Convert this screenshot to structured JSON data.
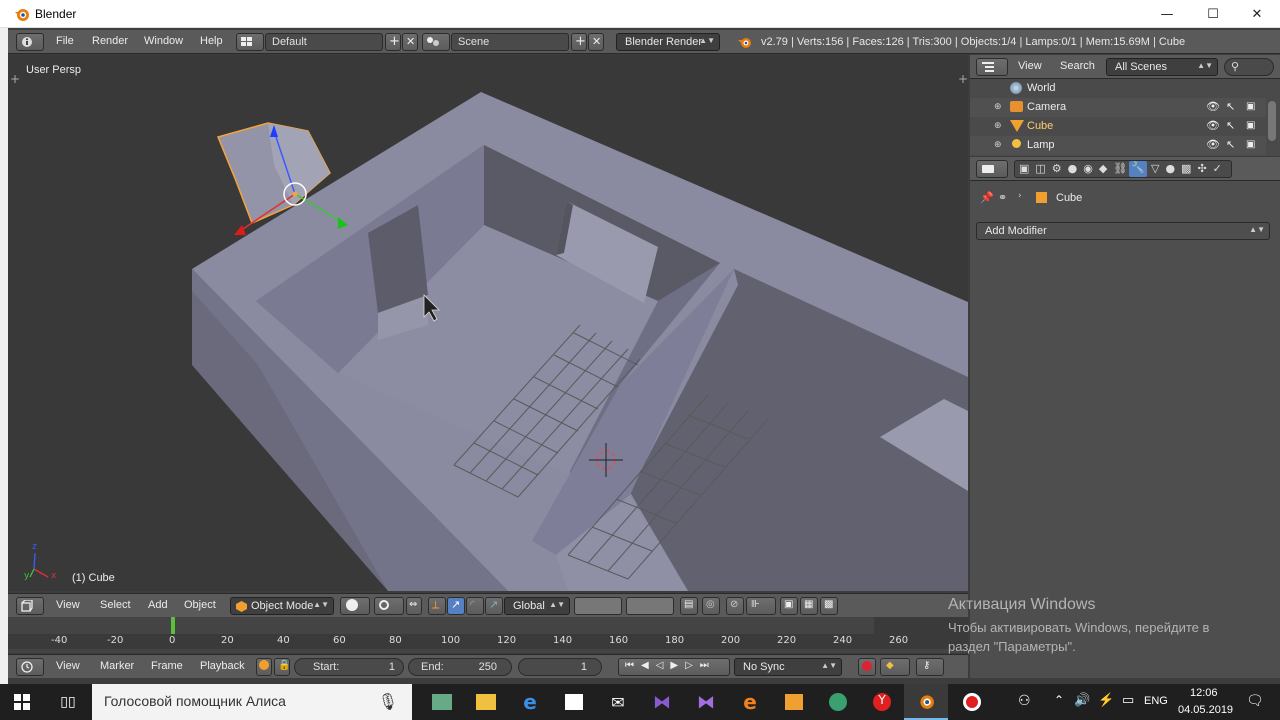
{
  "window": {
    "title": "Blender",
    "minimize": "—",
    "maximize": "☐",
    "close": "✕"
  },
  "info_header": {
    "menus": [
      "File",
      "Render",
      "Window",
      "Help"
    ],
    "layout": "Default",
    "scene": "Scene",
    "engine": "Blender Render",
    "stats": "v2.79 | Verts:156 | Faces:126 | Tris:300 | Objects:1/4 | Lamps:0/1 | Mem:15.69M | Cube"
  },
  "viewport": {
    "view_label": "User Persp",
    "object_label": "(1) Cube",
    "axes": {
      "x": "x",
      "y": "y",
      "z": "z"
    },
    "colors": {
      "bg": "#393939",
      "wall_top": "#8a8aa0",
      "wall_side": "#6d6d80",
      "floor": "#7a7a90",
      "dark_side": "#565661",
      "selection": "#f4a43a"
    }
  },
  "viewport_header": {
    "menus": [
      "View",
      "Select",
      "Add",
      "Object"
    ],
    "mode": "Object Mode",
    "orientation": "Global"
  },
  "timeline": {
    "ticks": [
      "-40",
      "-20",
      "0",
      "20",
      "40",
      "60",
      "80",
      "100",
      "120",
      "140",
      "160",
      "180",
      "200",
      "220",
      "240",
      "260"
    ],
    "current_frame_marker": "0"
  },
  "timeline_header": {
    "menus": [
      "View",
      "Marker",
      "Frame",
      "Playback"
    ],
    "start_label": "Start:",
    "start_value": "1",
    "end_label": "End:",
    "end_value": "250",
    "current_frame": "1",
    "sync": "No Sync"
  },
  "outliner": {
    "menus": [
      "View",
      "Search"
    ],
    "scenes_filter": "All Scenes",
    "items": [
      {
        "name": "World",
        "icon": "world-icon"
      },
      {
        "name": "Camera",
        "icon": "camera-icon"
      },
      {
        "name": "Cube",
        "icon": "mesh-icon"
      },
      {
        "name": "Lamp",
        "icon": "lamp-icon"
      }
    ]
  },
  "properties": {
    "context_object": "Cube",
    "add_modifier": "Add Modifier"
  },
  "watermark": {
    "line1": "Активация Windows",
    "line2": "Чтобы активировать Windows, перейдите в раздел \"Параметры\"."
  },
  "taskbar": {
    "search_placeholder": "Голосовой помощник Алиса",
    "language": "ENG",
    "time": "12:06",
    "date": "04.05.2019"
  }
}
